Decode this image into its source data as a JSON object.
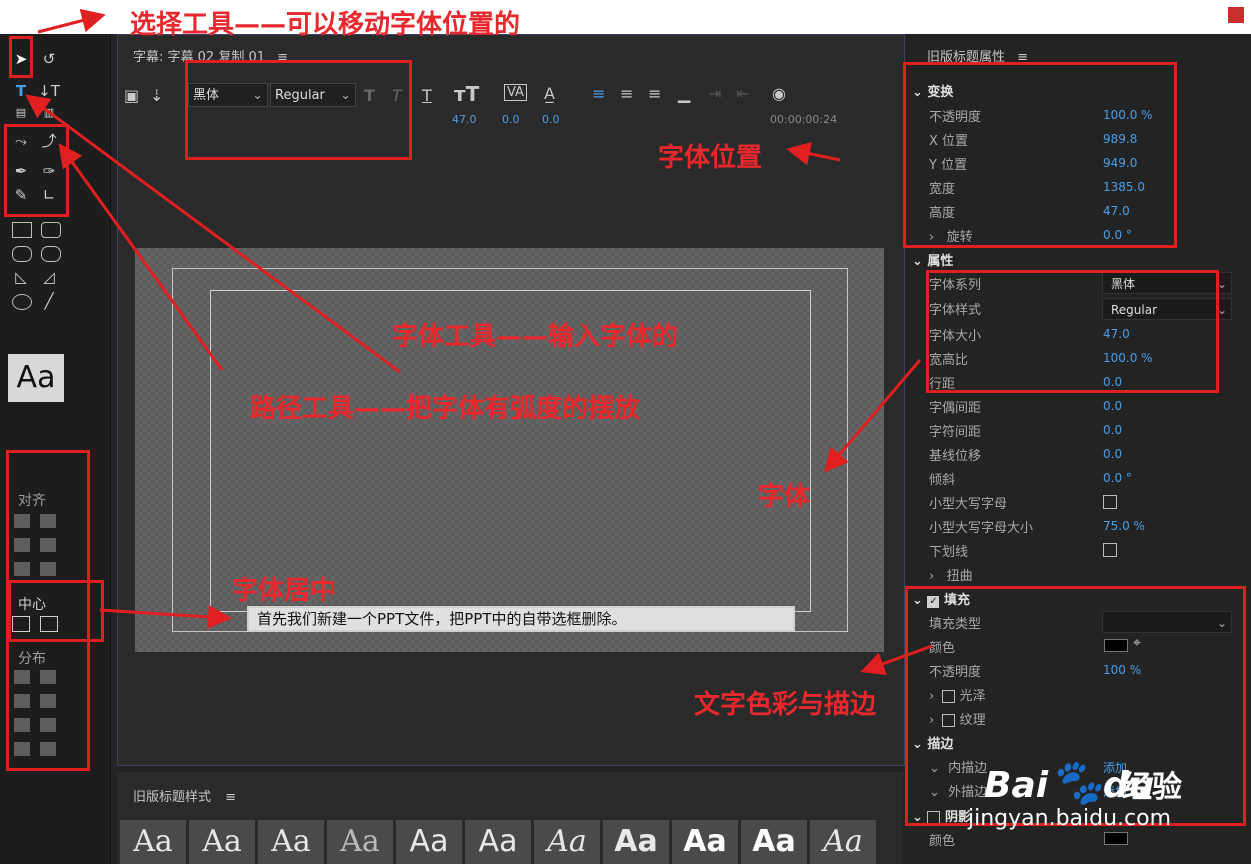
{
  "annotations": {
    "select_tool": "选择工具——可以移动字体位置的",
    "font_position": "字体位置",
    "type_tool": "字体工具——输入字体的",
    "path_tool": "路径工具——把字体有弧度的摆放",
    "font": "字体",
    "center": "字体居中",
    "color_stroke": "文字色彩与描边"
  },
  "tools": {
    "aa_preview": "Aa"
  },
  "align_panel": {
    "align": "对齐",
    "center": "中心",
    "distribute": "分布"
  },
  "center_panel": {
    "title": "字幕: 字幕 02 复制 01",
    "menu": "≡",
    "font_family": "黑体",
    "font_style": "Regular",
    "font_size": "47.0",
    "kerning": "0.0",
    "leading": "0.0",
    "timecode": "00:00:00:24",
    "canvas_text": "首先我们新建一个PPT文件，把PPT中的自带选框删除。"
  },
  "styles_panel": {
    "title": "旧版标题样式",
    "menu": "≡",
    "swatch_label": "Aa"
  },
  "right_panel": {
    "title": "旧版标题属性",
    "menu": "≡",
    "transform": {
      "header": "变换",
      "rows": [
        {
          "label": "不透明度",
          "value": "100.0 %"
        },
        {
          "label": "X 位置",
          "value": "989.8"
        },
        {
          "label": "Y 位置",
          "value": "949.0"
        },
        {
          "label": "宽度",
          "value": "1385.0"
        },
        {
          "label": "高度",
          "value": "47.0"
        },
        {
          "label": "旋转",
          "value": "0.0 °"
        }
      ]
    },
    "properties": {
      "header": "属性",
      "font_family_label": "字体系列",
      "font_family_value": "黑体",
      "font_style_label": "字体样式",
      "font_style_value": "Regular",
      "rows": [
        {
          "label": "字体大小",
          "value": "47.0"
        },
        {
          "label": "宽高比",
          "value": "100.0 %"
        },
        {
          "label": "行距",
          "value": "0.0"
        },
        {
          "label": "字偶间距",
          "value": "0.0"
        },
        {
          "label": "字符间距",
          "value": "0.0"
        },
        {
          "label": "基线位移",
          "value": "0.0"
        },
        {
          "label": "倾斜",
          "value": "0.0 °"
        }
      ],
      "small_caps": "小型大写字母",
      "small_caps_size": "小型大写字母大小",
      "small_caps_size_value": "75.0 %",
      "underline": "下划线",
      "distort": "扭曲"
    },
    "fill": {
      "header": "填充",
      "fill_type": "填充类型",
      "color": "颜色",
      "opacity": "不透明度",
      "opacity_value": "100 %",
      "sheen": "光泽",
      "texture": "纹理"
    },
    "stroke": {
      "header": "描边",
      "inner": "内描边",
      "outer": "外描边",
      "add": "添加"
    },
    "shadow": {
      "header": "阴影",
      "color": "颜色"
    }
  },
  "watermark": {
    "brand": "Bai",
    "brand_du": "du",
    "jingyan": "经验",
    "url": "jingyan.baidu.com"
  }
}
